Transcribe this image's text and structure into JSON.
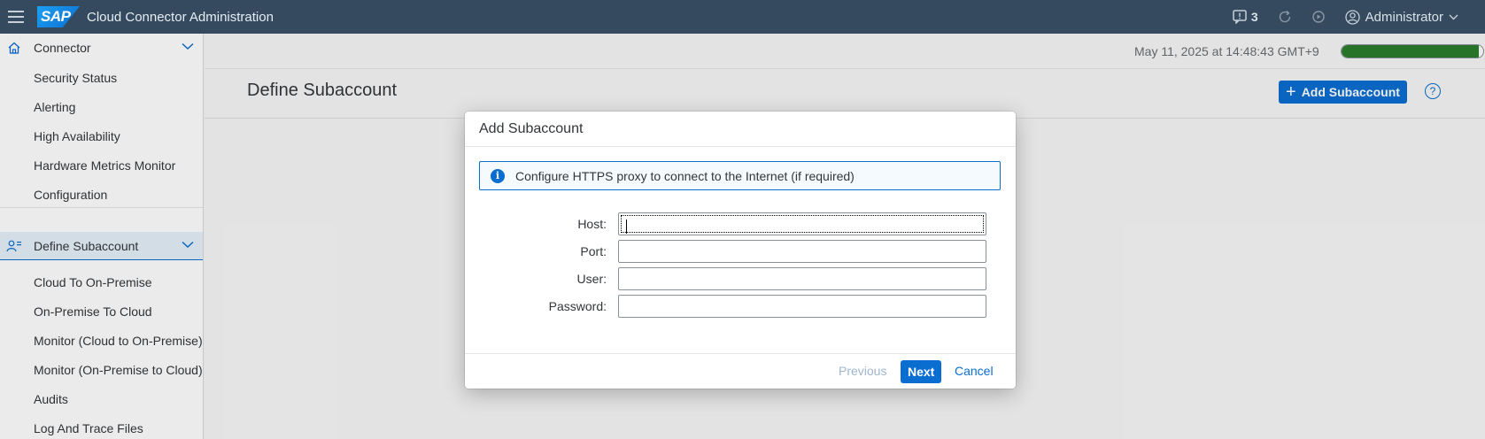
{
  "shell": {
    "logo_text": "SAP",
    "app_title": "Cloud Connector Administration",
    "notifications_count": "3",
    "user_name": "Administrator"
  },
  "sidebar": {
    "connector_group": {
      "label": "Connector",
      "items": [
        "Security Status",
        "Alerting",
        "High Availability",
        "Hardware Metrics Monitor",
        "Configuration"
      ]
    },
    "subaccount_group": {
      "label": "Define Subaccount",
      "items": [
        "Cloud To On-Premise",
        "On-Premise To Cloud",
        "Monitor (Cloud to On-Premise)",
        "Monitor (On-Premise to Cloud)",
        "Audits",
        "Log And Trace Files"
      ]
    }
  },
  "main": {
    "datetime": "May 11, 2025 at 14:48:43 GMT+9",
    "progress_fraction": 0.97,
    "page_title": "Define Subaccount",
    "add_button_label": "Add Subaccount",
    "help_symbol": "?"
  },
  "dialog": {
    "title": "Add Subaccount",
    "info_text": "Configure HTTPS proxy to connect to the Internet (if required)",
    "fields": {
      "host_label": "Host:",
      "host_value": "",
      "port_label": "Port:",
      "port_value": "",
      "user_label": "User:",
      "user_value": "",
      "password_label": "Password:",
      "password_value": ""
    },
    "buttons": {
      "previous": "Previous",
      "next": "Next",
      "cancel": "Cancel"
    }
  },
  "colors": {
    "shell_bg": "#354a5f",
    "accent": "#0a6ed1",
    "progress_fill": "#2b7d2b"
  }
}
